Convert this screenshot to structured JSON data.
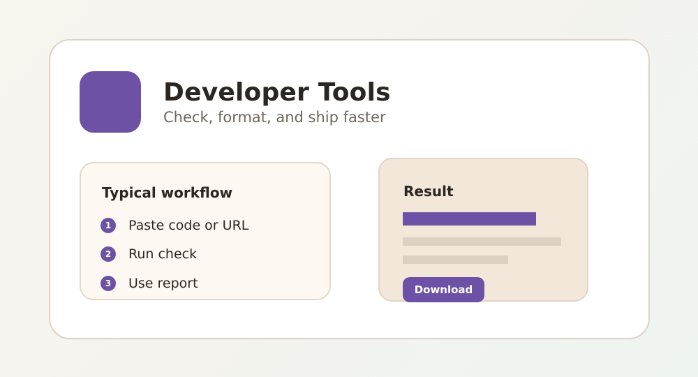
{
  "header": {
    "title": "Developer Tools",
    "subtitle": "Check, format, and ship faster"
  },
  "workflow": {
    "heading": "Typical workflow",
    "steps": [
      {
        "number": "1",
        "label": "Paste code or URL"
      },
      {
        "number": "2",
        "label": "Run check"
      },
      {
        "number": "3",
        "label": "Use report"
      }
    ]
  },
  "result": {
    "heading": "Result",
    "download_label": "Download"
  },
  "colors": {
    "accent": "#6c51a4",
    "placeholder_bar": "#dcd0c2",
    "workflow_panel": "#fdf8f1",
    "result_panel": "#f3e7da"
  }
}
